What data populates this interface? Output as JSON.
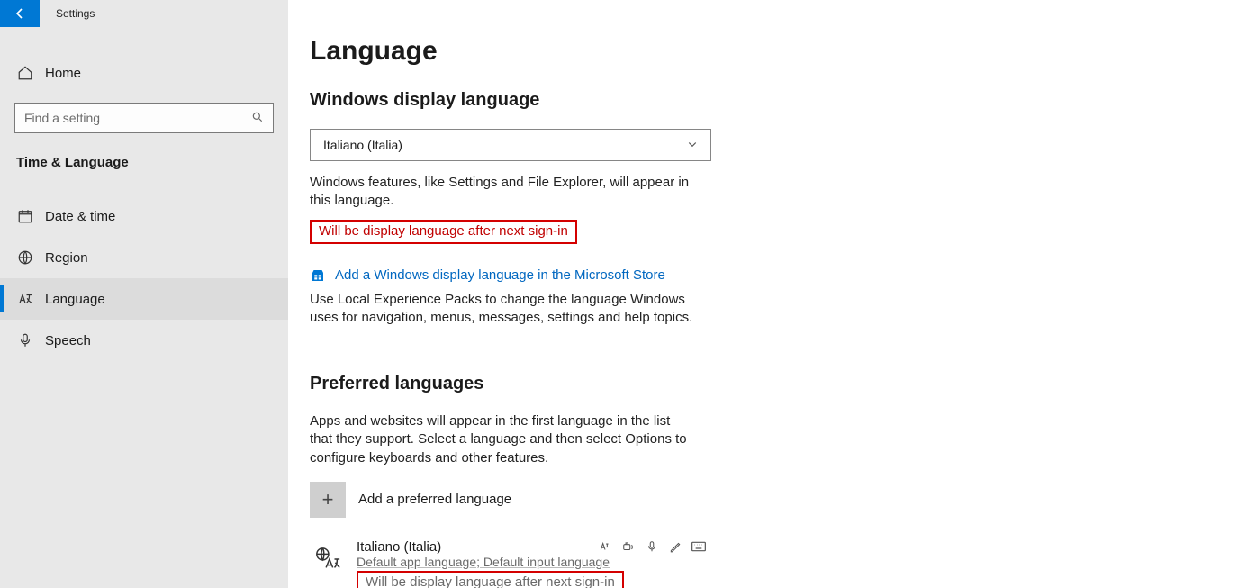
{
  "titlebar": {
    "app_name": "Settings"
  },
  "sidebar": {
    "home_label": "Home",
    "search_placeholder": "Find a setting",
    "section_title": "Time & Language",
    "items": [
      {
        "label": "Date & time"
      },
      {
        "label": "Region"
      },
      {
        "label": "Language"
      },
      {
        "label": "Speech"
      }
    ]
  },
  "main": {
    "page_title": "Language",
    "display": {
      "heading": "Windows display language",
      "selected": "Italiano (Italia)",
      "description": "Windows features, like Settings and File Explorer, will appear in this language.",
      "pending_notice": "Will be display language after next sign-in",
      "store_link": "Add a Windows display language in the Microsoft Store",
      "store_desc": "Use Local Experience Packs to change the language Windows uses for navigation, menus, messages, settings and help topics."
    },
    "preferred": {
      "heading": "Preferred languages",
      "description": "Apps and websites will appear in the first language in the list that they support. Select a language and then select Options to configure keyboards and other features.",
      "add_label": "Add a preferred language",
      "language": {
        "name": "Italiano (Italia)",
        "subtitle": "Default app language; Default input language",
        "pending_notice": "Will be display language after next sign-in"
      }
    }
  }
}
